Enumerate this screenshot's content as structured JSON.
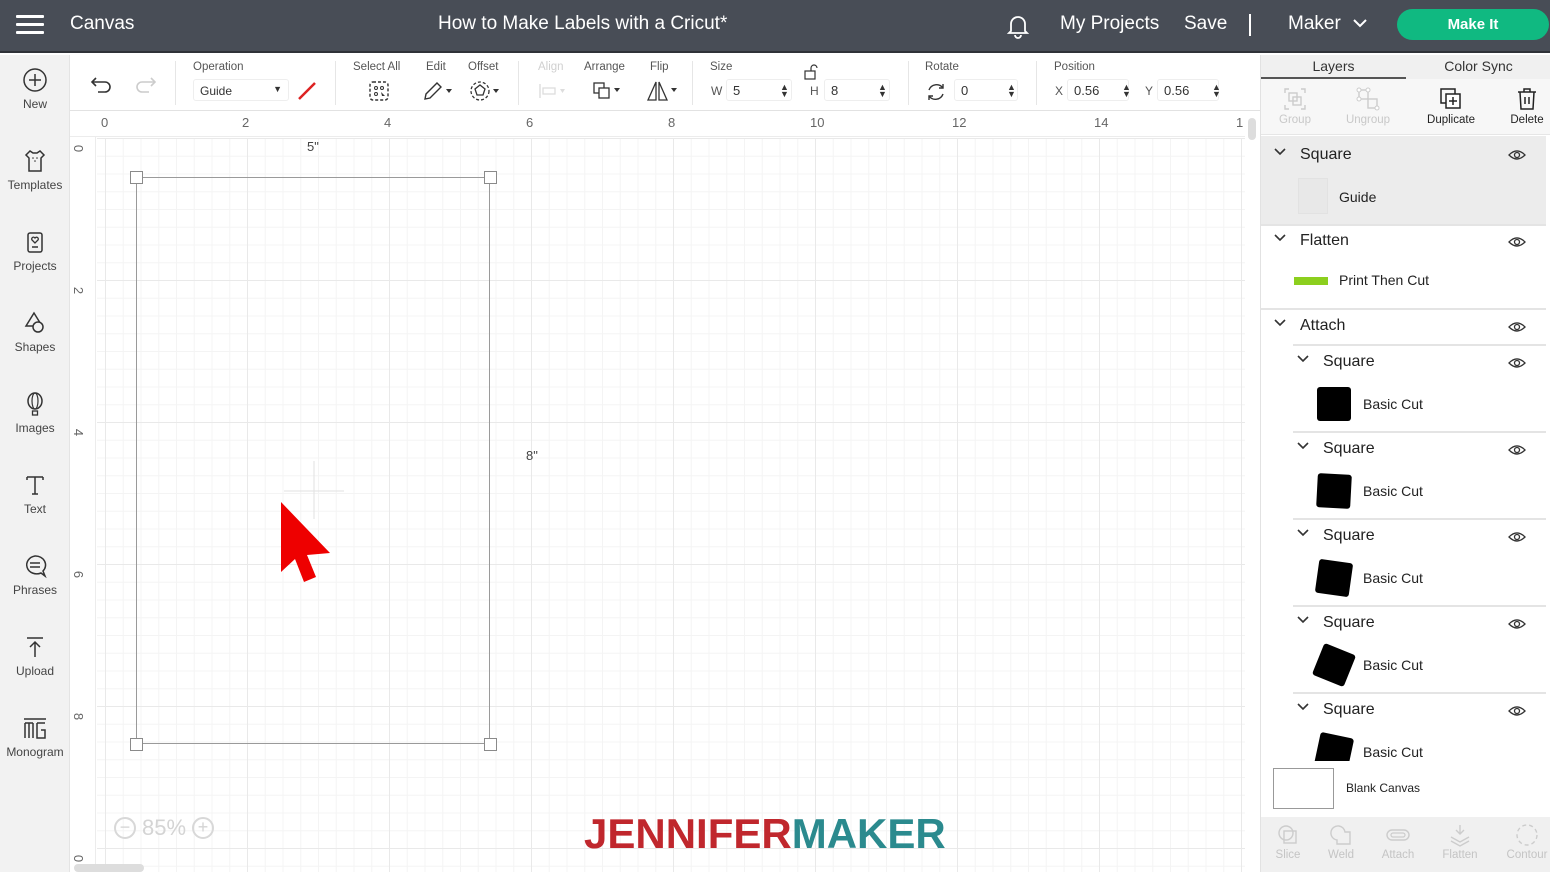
{
  "topbar": {
    "app_title": "Canvas",
    "document_title": "How to Make Labels with a Cricut*",
    "my_projects": "My Projects",
    "save": "Save",
    "machine": "Maker",
    "make_it": "Make It",
    "make_it_color": "#10b981"
  },
  "leftnav": {
    "items": [
      {
        "label": "New",
        "icon": "plus-circle-icon"
      },
      {
        "label": "Templates",
        "icon": "shirt-icon"
      },
      {
        "label": "Projects",
        "icon": "project-card-icon"
      },
      {
        "label": "Shapes",
        "icon": "shapes-icon"
      },
      {
        "label": "Images",
        "icon": "balloon-icon"
      },
      {
        "label": "Text",
        "icon": "text-icon"
      },
      {
        "label": "Phrases",
        "icon": "speech-bubble-icon"
      },
      {
        "label": "Upload",
        "icon": "upload-icon"
      },
      {
        "label": "Monogram",
        "icon": "monogram-icon"
      }
    ]
  },
  "toolbar": {
    "operation_label": "Operation",
    "operation_value": "Guide",
    "select_all": "Select All",
    "edit": "Edit",
    "offset": "Offset",
    "align": "Align",
    "arrange": "Arrange",
    "flip": "Flip",
    "size_label": "Size",
    "w_label": "W",
    "w_value": "5",
    "h_label": "H",
    "h_value": "8",
    "rotate_label": "Rotate",
    "rotate_value": "0",
    "position_label": "Position",
    "x_label": "X",
    "x_value": "0.56",
    "y_label": "Y",
    "y_value": "0.56"
  },
  "canvas": {
    "ruler_top": [
      "0",
      "2",
      "4",
      "6",
      "8",
      "10",
      "12",
      "14",
      "1"
    ],
    "ruler_left": [
      "0",
      "2",
      "4",
      "6",
      "8",
      "0"
    ],
    "width_dim": "5\"",
    "height_dim": "8\"",
    "zoom": "85%",
    "logo_part1": "JENNIFER",
    "logo_part2": "MAKER",
    "logo_color1": "#c0272d",
    "logo_color2": "#2b8a8e"
  },
  "rpanel": {
    "tabs": [
      "Layers",
      "Color Sync"
    ],
    "actions": [
      "Group",
      "Ungroup",
      "Duplicate",
      "Delete"
    ],
    "layers": [
      {
        "name": "Square",
        "sub": "Guide"
      },
      {
        "name": "Flatten",
        "sub": "Print Then Cut"
      },
      {
        "name": "Attach",
        "children": [
          {
            "name": "Square",
            "sub": "Basic Cut"
          },
          {
            "name": "Square",
            "sub": "Basic Cut"
          },
          {
            "name": "Square",
            "sub": "Basic Cut"
          },
          {
            "name": "Square",
            "sub": "Basic Cut"
          },
          {
            "name": "Square",
            "sub": "Basic Cut"
          }
        ]
      }
    ],
    "blank_canvas": "Blank Canvas",
    "bottom_actions": [
      "Slice",
      "Weld",
      "Attach",
      "Flatten",
      "Contour"
    ]
  }
}
